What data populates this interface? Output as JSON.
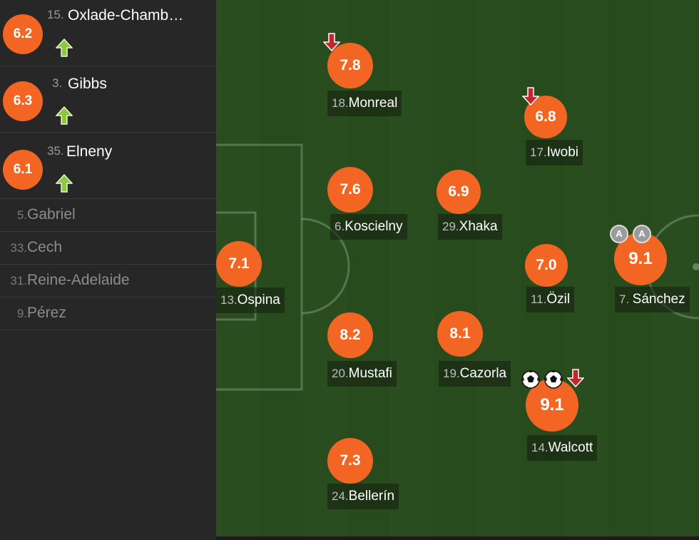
{
  "substitutes": [
    {
      "number": "15.",
      "name": "Oxlade-Chamb…",
      "rating": "6.2",
      "icon": "sub-on-arrow-icon"
    },
    {
      "number": "3.",
      "name": "Gibbs",
      "rating": "6.3",
      "icon": "sub-on-arrow-icon"
    },
    {
      "number": "35.",
      "name": "Elneny",
      "rating": "6.1",
      "icon": "sub-on-arrow-icon"
    }
  ],
  "bench": [
    {
      "number": "5.",
      "name": "Gabriel"
    },
    {
      "number": "33.",
      "name": "Cech"
    },
    {
      "number": "31.",
      "name": "Reine-Adelaide"
    },
    {
      "number": "9.",
      "name": "Pérez"
    }
  ],
  "players": [
    {
      "number": "13.",
      "name": "Ospina",
      "rating": "7.1"
    },
    {
      "number": "18.",
      "name": "Monreal",
      "rating": "7.8",
      "icon": "sub-off-arrow-icon"
    },
    {
      "number": "6.",
      "name": "Koscielny",
      "rating": "7.6"
    },
    {
      "number": "20.",
      "name": "Mustafi",
      "rating": "8.2"
    },
    {
      "number": "24.",
      "name": "Bellerín",
      "rating": "7.3"
    },
    {
      "number": "29.",
      "name": "Xhaka",
      "rating": "6.9"
    },
    {
      "number": "19.",
      "name": "Cazorla",
      "rating": "8.1"
    },
    {
      "number": "17.",
      "name": "Iwobi",
      "rating": "6.8",
      "icon": "sub-off-arrow-icon"
    },
    {
      "number": "11.",
      "name": "Özil",
      "rating": "7.0"
    },
    {
      "number": "14.",
      "name": "Walcott",
      "rating": "9.1",
      "icons": [
        "goal-ball-icon",
        "goal-ball-icon",
        "sub-off-arrow-icon"
      ]
    },
    {
      "number": "7.",
      "name": "Sánchez",
      "rating": "9.1",
      "icons": [
        "assist-icon",
        "assist-icon"
      ],
      "assist_badge": "A"
    }
  ],
  "colors": {
    "rating": "#f26522",
    "sub_on": "#8dc63f",
    "sub_off": "#c1272d",
    "pitch": "#2a4d1f"
  }
}
